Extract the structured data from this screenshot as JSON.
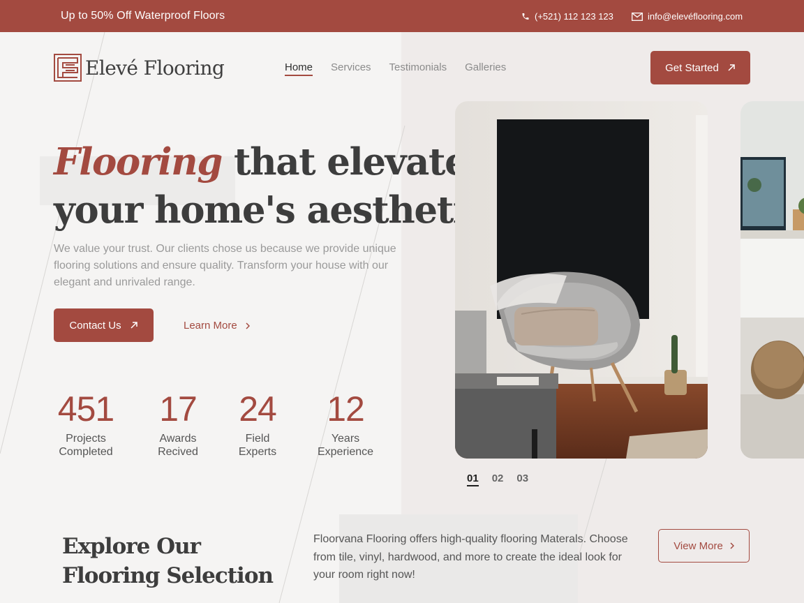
{
  "topbar": {
    "promo": "Up to 50% Off Waterproof Floors",
    "phone": "(+521) 112 123 123",
    "email": "info@elevéflooring.com"
  },
  "brand": {
    "name": "Elevé Flooring",
    "accent_color": "#a34a40"
  },
  "nav": {
    "items": [
      {
        "label": "Home",
        "active": true
      },
      {
        "label": "Services",
        "active": false
      },
      {
        "label": "Testimonials",
        "active": false
      },
      {
        "label": "Galleries",
        "active": false
      }
    ],
    "cta": "Get Started"
  },
  "hero": {
    "title_accent": "Flooring",
    "title_rest": "that elevates",
    "title_line2": "your home's aesthetic",
    "description": "We value your trust. Our clients chose us because we provide unique flooring solutions and ensure quality. Transform your house with our elegant and unrivaled range.",
    "primary_cta": "Contact Us",
    "secondary_cta": "Learn More"
  },
  "stats": [
    {
      "value": "451",
      "label_line1": "Projects",
      "label_line2": "Completed"
    },
    {
      "value": "17",
      "label_line1": "Awards",
      "label_line2": "Recived"
    },
    {
      "value": "24",
      "label_line1": "Field",
      "label_line2": "Experts"
    },
    {
      "value": "12",
      "label_line1": "Years",
      "label_line2": "Experience"
    }
  ],
  "slider": {
    "pages": [
      "01",
      "02",
      "03"
    ],
    "active_page": "01"
  },
  "explore": {
    "title": "Explore Our Flooring Selection",
    "description": "Floorvana Flooring offers high-quality flooring Materals. Choose from tile, vinyl, hardwood, and more to create the ideal look for your room right now!",
    "cta": "View More"
  }
}
